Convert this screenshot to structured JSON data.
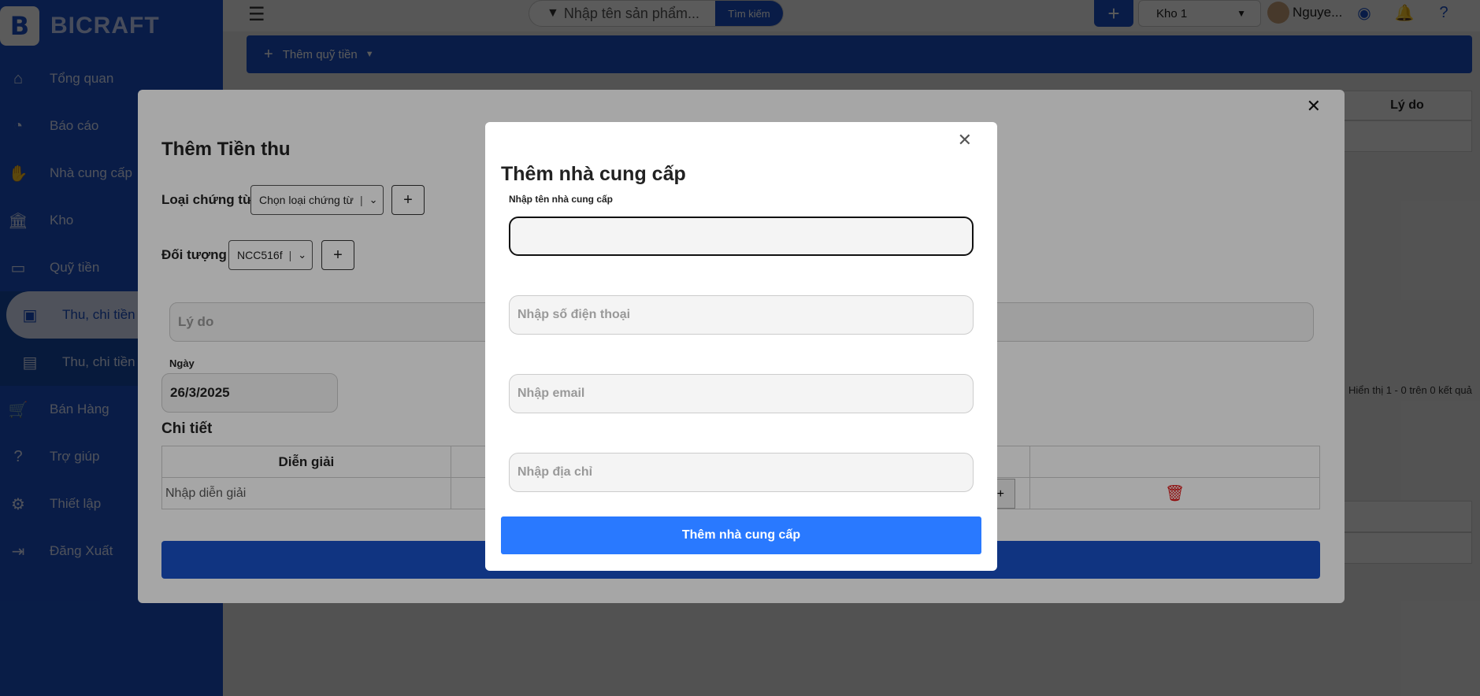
{
  "sidebar": {
    "logo_text": "BICRAFT",
    "items": [
      {
        "label": "Tổng quan",
        "icon": "home-icon"
      },
      {
        "label": "Báo cáo",
        "icon": "pie-chart-icon"
      },
      {
        "label": "Nhà cung cấp",
        "icon": "handshake-icon"
      },
      {
        "label": "Kho",
        "icon": "bank-icon"
      },
      {
        "label": "Quỹ tiền",
        "icon": "wallet-icon"
      }
    ],
    "sub_items": [
      {
        "label": "Thu, chi tiền n",
        "icon": "money-icon",
        "active": true
      },
      {
        "label": "Thu, chi tiền g",
        "icon": "card-icon",
        "active": false
      }
    ],
    "items_after": [
      {
        "label": "Bán Hàng",
        "icon": "cart-icon"
      },
      {
        "label": "Trợ giúp",
        "icon": "help-icon"
      },
      {
        "label": "Thiết lập",
        "icon": "gear-icon"
      },
      {
        "label": "Đăng Xuất",
        "icon": "logout-icon"
      }
    ]
  },
  "topbar": {
    "search_placeholder": "Nhập tên sản phẩm...",
    "search_button": "Tìm kiếm",
    "warehouse": "Kho 1",
    "user_name": "Nguye..."
  },
  "main_bar": {
    "label": "Thêm quỹ tiền"
  },
  "background": {
    "col_reason": "Lý do",
    "pagination": "Hiển thị 1 - 0 trên 0 kết quả"
  },
  "modal_receipt": {
    "title": "Thêm Tiền thu",
    "doc_type_label": "Loại chứng từ",
    "doc_type_value": "Chọn loại chứng từ",
    "object_label": "Đối tượng",
    "object_value": "NCC516f",
    "reason_placeholder": "Lý do",
    "date_label": "Ngày",
    "date_value": "26/3/2025",
    "detail_title": "Chi tiết",
    "table_header_desc": "Diễn giải",
    "table_desc_placeholder": "Nhập diễn giải"
  },
  "modal_supplier": {
    "title": "Thêm nhà cung cấp",
    "name_label": "Nhập tên nhà cung cấp",
    "phone_placeholder": "Nhập số điện thoại",
    "email_placeholder": "Nhập email",
    "address_placeholder": "Nhập địa chỉ",
    "submit_label": "Thêm nhà cung cấp"
  },
  "colors": {
    "brand": "#1a50c6",
    "submit": "#2979ff",
    "danger": "#dd1111"
  }
}
